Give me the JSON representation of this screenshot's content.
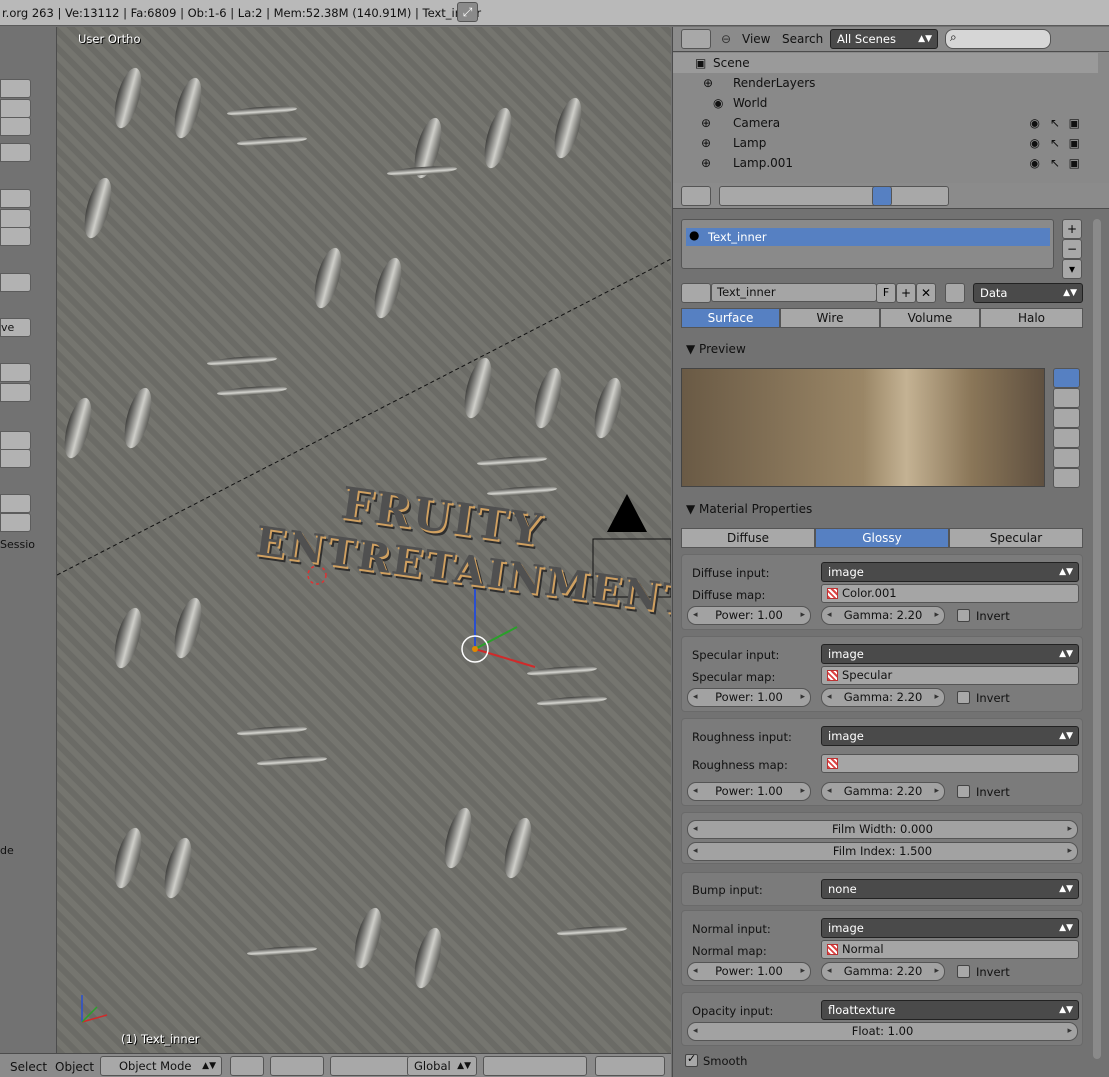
{
  "info": {
    "stats": "r.org 263 | Ve:13112 | Fa:6809 | Ob:1-6 | La:2 | Mem:52.38M (140.91M) | Text_inner"
  },
  "toolshelf": {
    "items": [
      "ve",
      "Sessio",
      "de"
    ]
  },
  "viewport": {
    "view_label": "User Ortho",
    "object_label": "(1) Text_inner",
    "text_line1": "FRUITY",
    "text_line2": "ENTRETAINMENT"
  },
  "outliner": {
    "menus": [
      "View",
      "Search"
    ],
    "display_mode": "All Scenes",
    "search_placeholder": "",
    "rows": [
      "Scene",
      "RenderLayers",
      "World",
      "Camera",
      "Lamp",
      "Lamp.001"
    ]
  },
  "properties": {
    "slot_name": "Text_inner",
    "material_name": "Text_inner",
    "fake_user": "F",
    "link": "Data",
    "tabs": [
      "Surface",
      "Wire",
      "Volume",
      "Halo"
    ],
    "active_tab": "Surface",
    "preview_title": "Preview",
    "matprops_title": "Material Properties",
    "shader_tabs": [
      "Diffuse",
      "Glossy",
      "Specular"
    ],
    "active_shader": "Glossy",
    "diffuse": {
      "input_label": "Diffuse input:",
      "input": "image",
      "map_label": "Diffuse map:",
      "map": "Color.001",
      "power": "Power: 1.00",
      "gamma": "Gamma: 2.20",
      "invert": "Invert"
    },
    "specular": {
      "input_label": "Specular input:",
      "input": "image",
      "map_label": "Specular map:",
      "map": "Specular",
      "power": "Power: 1.00",
      "gamma": "Gamma: 2.20",
      "invert": "Invert"
    },
    "roughness": {
      "input_label": "Roughness input:",
      "input": "image",
      "map_label": "Roughness map:",
      "map": "",
      "power": "Power: 1.00",
      "gamma": "Gamma: 2.20",
      "invert": "Invert"
    },
    "film": {
      "width": "Film Width: 0.000",
      "index": "Film Index: 1.500"
    },
    "bump": {
      "input_label": "Bump input:",
      "input": "none"
    },
    "normal": {
      "input_label": "Normal input:",
      "input": "image",
      "map_label": "Normal map:",
      "map": "Normal",
      "power": "Power: 1.00",
      "gamma": "Gamma: 2.20",
      "invert": "Invert"
    },
    "opacity": {
      "input_label": "Opacity input:",
      "input": "floattexture",
      "float": "Float: 1.00"
    },
    "smooth": "Smooth"
  },
  "bottombar": {
    "select": "Select",
    "object": "Object",
    "mode": "Object Mode",
    "orientation": "Global"
  }
}
